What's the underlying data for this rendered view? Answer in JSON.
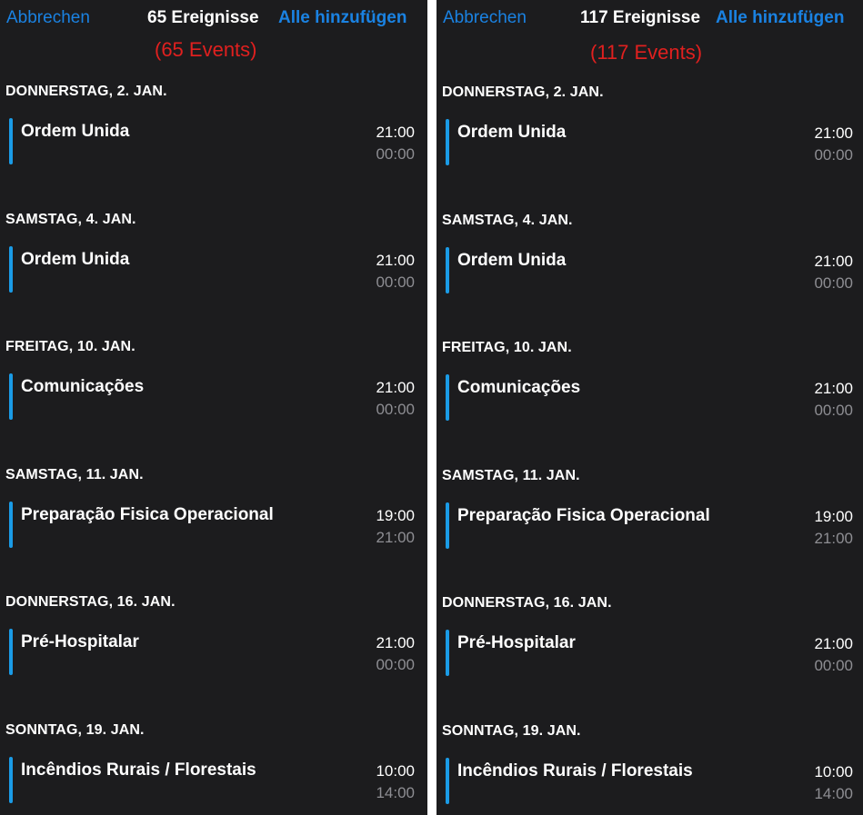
{
  "colors": {
    "background": "#1c1c1e",
    "accent": "#1a82e2",
    "event_bar": "#1a9be6",
    "annotation": "#e0201f",
    "secondary_text": "#8e8e93"
  },
  "panels": [
    {
      "cancel_label": "Abbrechen",
      "title": "65 Ereignisse",
      "add_all_label": "Alle hinzufügen",
      "annotation": "(65 Events)",
      "sections": [
        {
          "header": "DONNERSTAG, 2. JAN.",
          "event": {
            "title": "Ordem Unida",
            "start": "21:00",
            "end": "00:00"
          }
        },
        {
          "header": "SAMSTAG, 4. JAN.",
          "event": {
            "title": "Ordem Unida",
            "start": "21:00",
            "end": "00:00"
          }
        },
        {
          "header": "FREITAG, 10. JAN.",
          "event": {
            "title": "Comunicações",
            "start": "21:00",
            "end": "00:00"
          }
        },
        {
          "header": "SAMSTAG, 11. JAN.",
          "event": {
            "title": "Preparação Fisica Operacional",
            "start": "19:00",
            "end": "21:00"
          }
        },
        {
          "header": "DONNERSTAG, 16. JAN.",
          "event": {
            "title": "Pré-Hospitalar",
            "start": "21:00",
            "end": "00:00"
          }
        },
        {
          "header": "SONNTAG, 19. JAN.",
          "event": {
            "title": "Incêndios Rurais / Florestais",
            "start": "10:00",
            "end": "14:00"
          }
        }
      ]
    },
    {
      "cancel_label": "Abbrechen",
      "title": "117 Ereignisse",
      "add_all_label": "Alle hinzufügen",
      "annotation": "(117 Events)",
      "sections": [
        {
          "header": "DONNERSTAG, 2. JAN.",
          "event": {
            "title": "Ordem Unida",
            "start": "21:00",
            "end": "00:00"
          }
        },
        {
          "header": "SAMSTAG, 4. JAN.",
          "event": {
            "title": "Ordem Unida",
            "start": "21:00",
            "end": "00:00"
          }
        },
        {
          "header": "FREITAG, 10. JAN.",
          "event": {
            "title": "Comunicações",
            "start": "21:00",
            "end": "00:00"
          }
        },
        {
          "header": "SAMSTAG, 11. JAN.",
          "event": {
            "title": "Preparação Fisica Operacional",
            "start": "19:00",
            "end": "21:00"
          }
        },
        {
          "header": "DONNERSTAG, 16. JAN.",
          "event": {
            "title": "Pré-Hospitalar",
            "start": "21:00",
            "end": "00:00"
          }
        },
        {
          "header": "SONNTAG, 19. JAN.",
          "event": {
            "title": "Incêndios Rurais / Florestais",
            "start": "10:00",
            "end": "14:00"
          }
        }
      ]
    }
  ]
}
